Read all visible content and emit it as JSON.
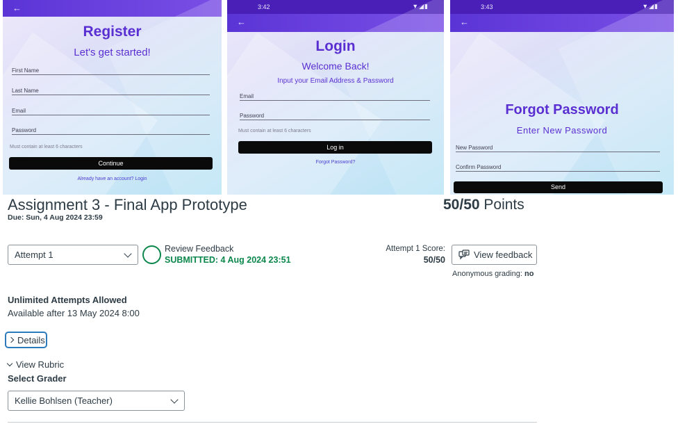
{
  "screens": {
    "register": {
      "title": "Register",
      "subtitle": "Let's get started!",
      "fields": [
        "First Name",
        "Last Name",
        "Email",
        "Password"
      ],
      "hint": "Must contain at least 6 characters",
      "button": "Continue",
      "link": "Already have an account? Login"
    },
    "login": {
      "time": "3:42",
      "title": "Login",
      "subtitle": "Welcome Back!",
      "instruction": "Input your Email Address & Password",
      "fields": [
        "Email",
        "Password"
      ],
      "hint": "Must contain at least 6 characters",
      "button": "Log in",
      "link": "Forgot Password?"
    },
    "forgot": {
      "time": "3:43",
      "title": "Forgot Password",
      "subtitle": "Enter New Password",
      "fields": [
        "New Password",
        "Confirm Password"
      ],
      "button": "Send"
    }
  },
  "assignment": {
    "title": "Assignment 3 - Final App Prototype",
    "due": "Due: Sun, 4 Aug 2024 23:59",
    "points_value": "50/50",
    "points_label": "Points",
    "attempt_selected": "Attempt 1",
    "review_feedback": "Review Feedback",
    "submitted": "SUBMITTED: 4 Aug 2024 23:51",
    "score_label": "Attempt 1 Score:",
    "score_value": "50/50",
    "view_feedback": "View feedback",
    "anon_label": "Anonymous grading:",
    "anon_value": "no",
    "unlimited": "Unlimited Attempts Allowed",
    "available": "Available after 13 May 2024 8:00",
    "details": "Details",
    "view_rubric": "View Rubric",
    "select_grader": "Select Grader",
    "grader_selected": "Kellie Bohlsen (Teacher)"
  },
  "colors": {
    "accent_purple": "#5a2fd2",
    "submitted_green": "#0b874b",
    "focus_blue": "#2b7abc",
    "text": "#2d3b45"
  }
}
